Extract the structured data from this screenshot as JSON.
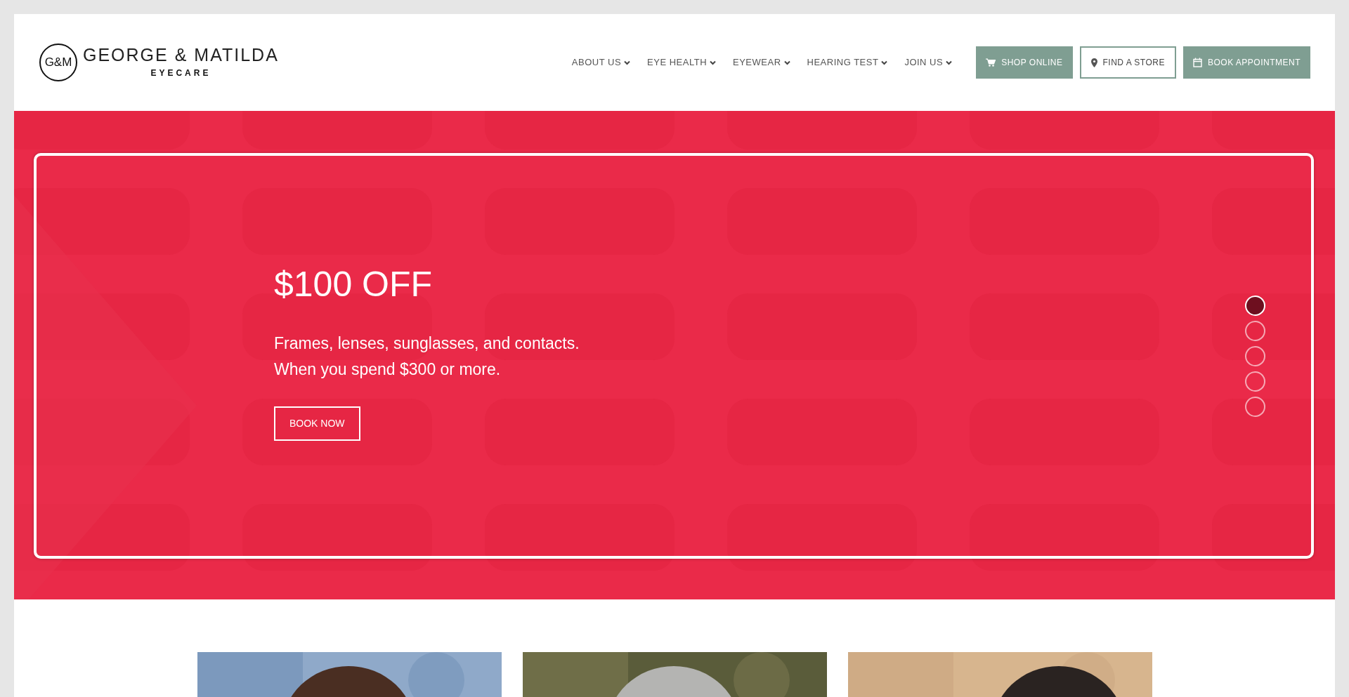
{
  "logo": {
    "monogram": "G&M",
    "name": "GEORGE & MATILDA",
    "tagline": "EYECARE"
  },
  "nav": [
    {
      "label": "ABOUT US",
      "dropdown": true
    },
    {
      "label": "EYE HEALTH",
      "dropdown": true
    },
    {
      "label": "EYEWEAR",
      "dropdown": true
    },
    {
      "label": "HEARING TEST",
      "dropdown": true
    },
    {
      "label": "JOIN US",
      "dropdown": true
    }
  ],
  "actions": [
    {
      "label": "SHOP ONLINE",
      "kind": "filled"
    },
    {
      "label": "FIND A STORE",
      "kind": "outline"
    },
    {
      "label": "BOOK APPOINTMENT",
      "kind": "filled"
    }
  ],
  "hero": {
    "title": "$100 OFF",
    "lines": [
      "Frames, lenses, sunglasses, and contacts.",
      "When you spend $300 or more."
    ],
    "button": "BOOK NOW",
    "slides": [
      {
        "selected": true
      },
      {
        "selected": false
      },
      {
        "selected": false
      },
      {
        "selected": false
      },
      {
        "selected": false
      }
    ]
  }
}
